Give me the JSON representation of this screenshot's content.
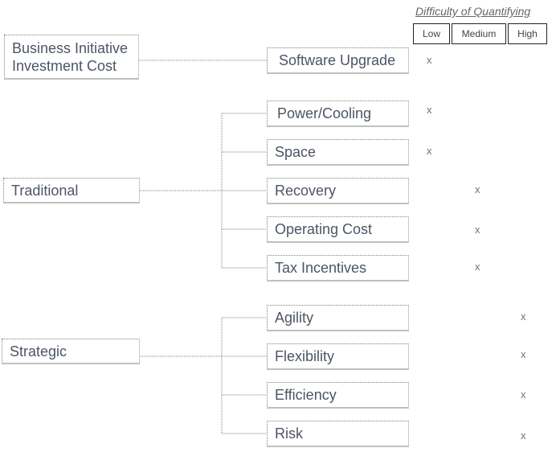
{
  "header": {
    "title": "Difficulty of Quantifying",
    "columns": [
      "Low",
      "Medium",
      "High"
    ]
  },
  "categories": [
    {
      "label": "Business Initiative Investment Cost",
      "items": [
        {
          "label": "Software Upgrade",
          "difficulty": "Low"
        }
      ]
    },
    {
      "label": "Traditional",
      "items": [
        {
          "label": "Power/Cooling",
          "difficulty": "Low"
        },
        {
          "label": "Space",
          "difficulty": "Low"
        },
        {
          "label": "Recovery",
          "difficulty": "Medium"
        },
        {
          "label": "Operating Cost",
          "difficulty": "Medium"
        },
        {
          "label": "Tax Incentives",
          "difficulty": "Medium"
        }
      ]
    },
    {
      "label": "Strategic",
      "items": [
        {
          "label": "Agility",
          "difficulty": "High"
        },
        {
          "label": "Flexibility",
          "difficulty": "High"
        },
        {
          "label": "Efficiency",
          "difficulty": "High"
        },
        {
          "label": "Risk",
          "difficulty": "High"
        }
      ]
    }
  ],
  "mark_symbol": "x"
}
